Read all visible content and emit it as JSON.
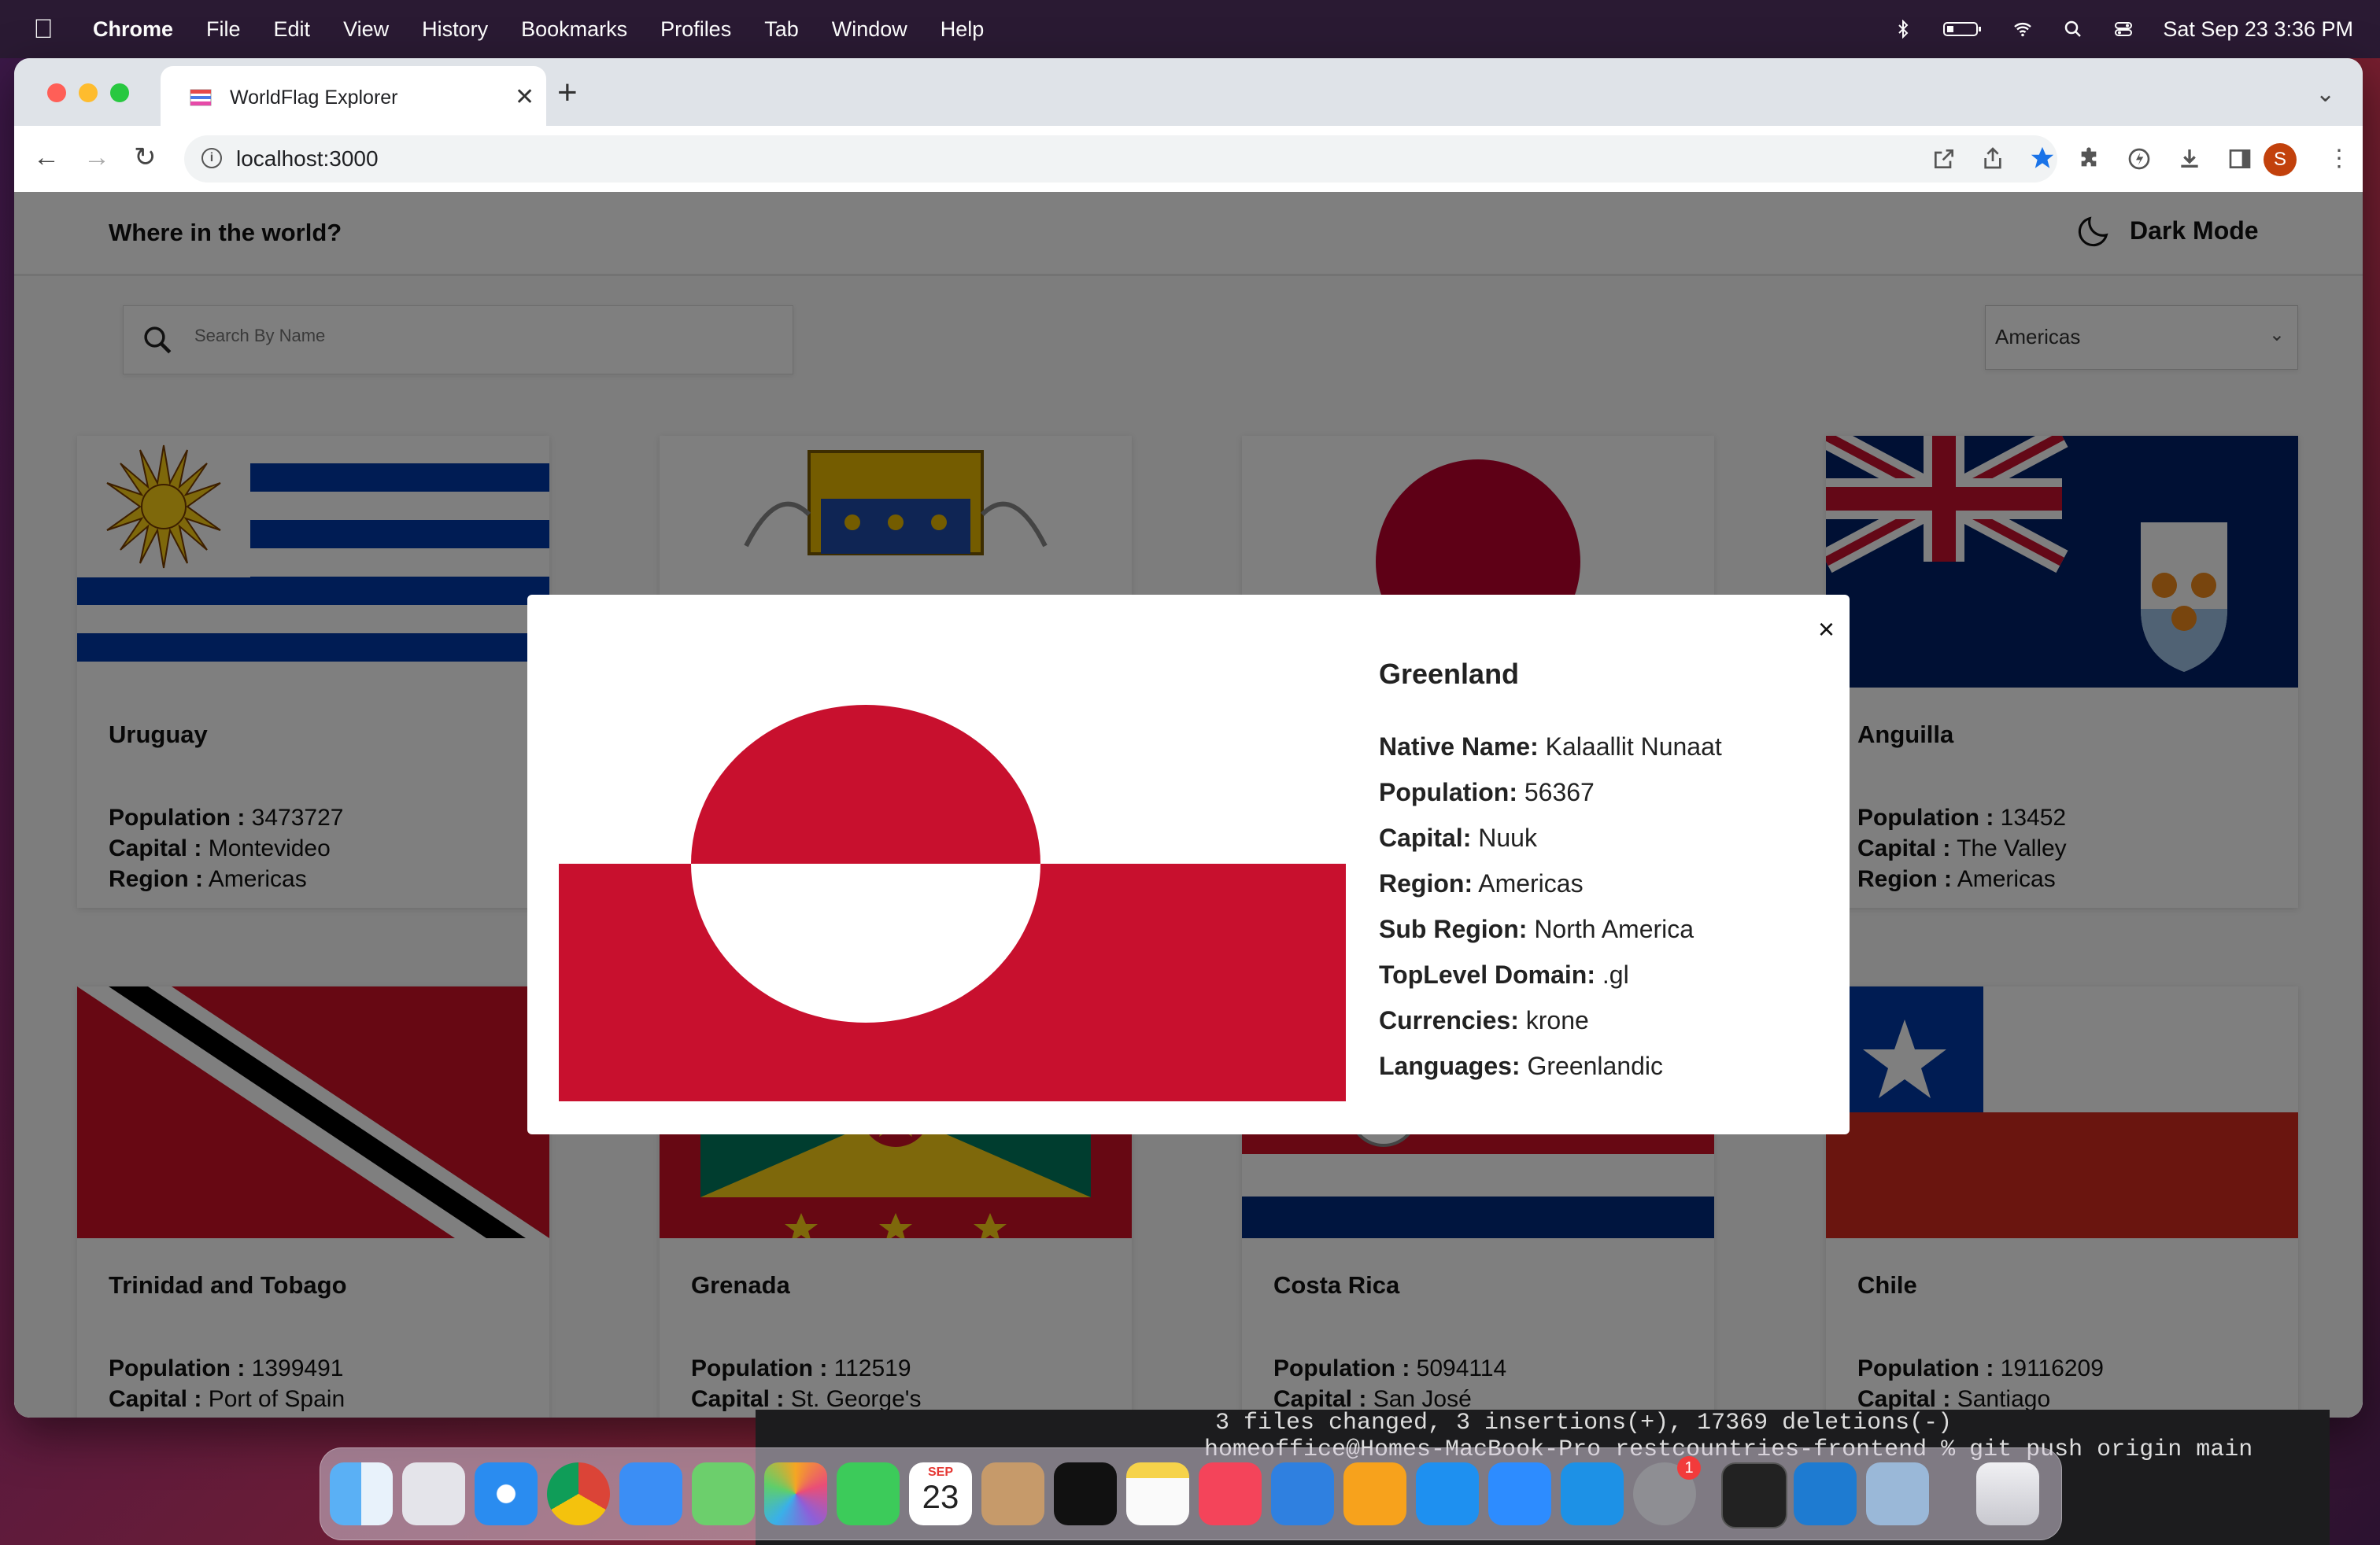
{
  "menubar": {
    "app": "Chrome",
    "items": [
      "File",
      "Edit",
      "View",
      "History",
      "Bookmarks",
      "Profiles",
      "Tab",
      "Window",
      "Help"
    ],
    "datetime": "Sat Sep 23  3:36 PM"
  },
  "browser": {
    "tab_title": "WorldFlag Explorer",
    "url": "localhost:3000"
  },
  "app": {
    "title": "Where in the world?",
    "dark_mode_label": "Dark Mode",
    "search_placeholder": "Search By Name",
    "region_filter": "Americas"
  },
  "labels": {
    "population": "Population :",
    "capital": "Capital :",
    "region": "Region :"
  },
  "cards": [
    {
      "name": "Uruguay",
      "population": "3473727",
      "capital": "Montevideo",
      "region": "Americas"
    },
    {
      "name": "",
      "population": "",
      "capital": "",
      "region": ""
    },
    {
      "name": "",
      "population": "",
      "capital": "",
      "region": ""
    },
    {
      "name": "Anguilla",
      "population": "13452",
      "capital": "The Valley",
      "region": "Americas"
    },
    {
      "name": "Trinidad and Tobago",
      "population": "1399491",
      "capital": "Port of Spain"
    },
    {
      "name": "Grenada",
      "population": "112519",
      "capital": "St. George's"
    },
    {
      "name": "Costa Rica",
      "population": "5094114",
      "capital": "San José"
    },
    {
      "name": "Chile",
      "population": "19116209",
      "capital": "Santiago"
    }
  ],
  "modal": {
    "country": "Greenland",
    "close_label": "×",
    "details": [
      {
        "label": "Native Name:",
        "value": "Kalaallit Nunaat"
      },
      {
        "label": "Population:",
        "value": "56367"
      },
      {
        "label": "Capital:",
        "value": "Nuuk"
      },
      {
        "label": "Region:",
        "value": "Americas"
      },
      {
        "label": "Sub Region:",
        "value": "North America"
      },
      {
        "label": "TopLevel Domain:",
        "value": ".gl"
      },
      {
        "label": "Currencies:",
        "value": "krone"
      },
      {
        "label": "Languages:",
        "value": "Greenlandic"
      }
    ]
  },
  "terminal": {
    "line1": "3 files changed, 3 insertions(+), 17369 deletions(-)",
    "line2": "homeoffice@Homes-MacBook-Pro restcountries-frontend % git push origin main"
  },
  "dock": {
    "calendar_month": "SEP",
    "calendar_day": "23",
    "settings_badge": "1",
    "apps": [
      "finder-icon",
      "launchpad-icon",
      "safari-icon",
      "chrome-icon",
      "mail-icon",
      "maps-icon",
      "photos-icon",
      "facetime-icon",
      "calendar-icon",
      "contacts-icon",
      "apple-tv-icon",
      "notes-icon",
      "music-icon",
      "keynote-icon",
      "pages-icon",
      "app-store-icon",
      "zoom-icon",
      "docker-icon",
      "system-settings-icon",
      "terminal-icon",
      "vscode-icon",
      "preview-icon",
      "trash-icon"
    ]
  },
  "colors": {
    "greenland_red": "#c8102e",
    "accent_blue": "#1a73e8",
    "overlay": "rgba(0,0,0,0.5)"
  }
}
